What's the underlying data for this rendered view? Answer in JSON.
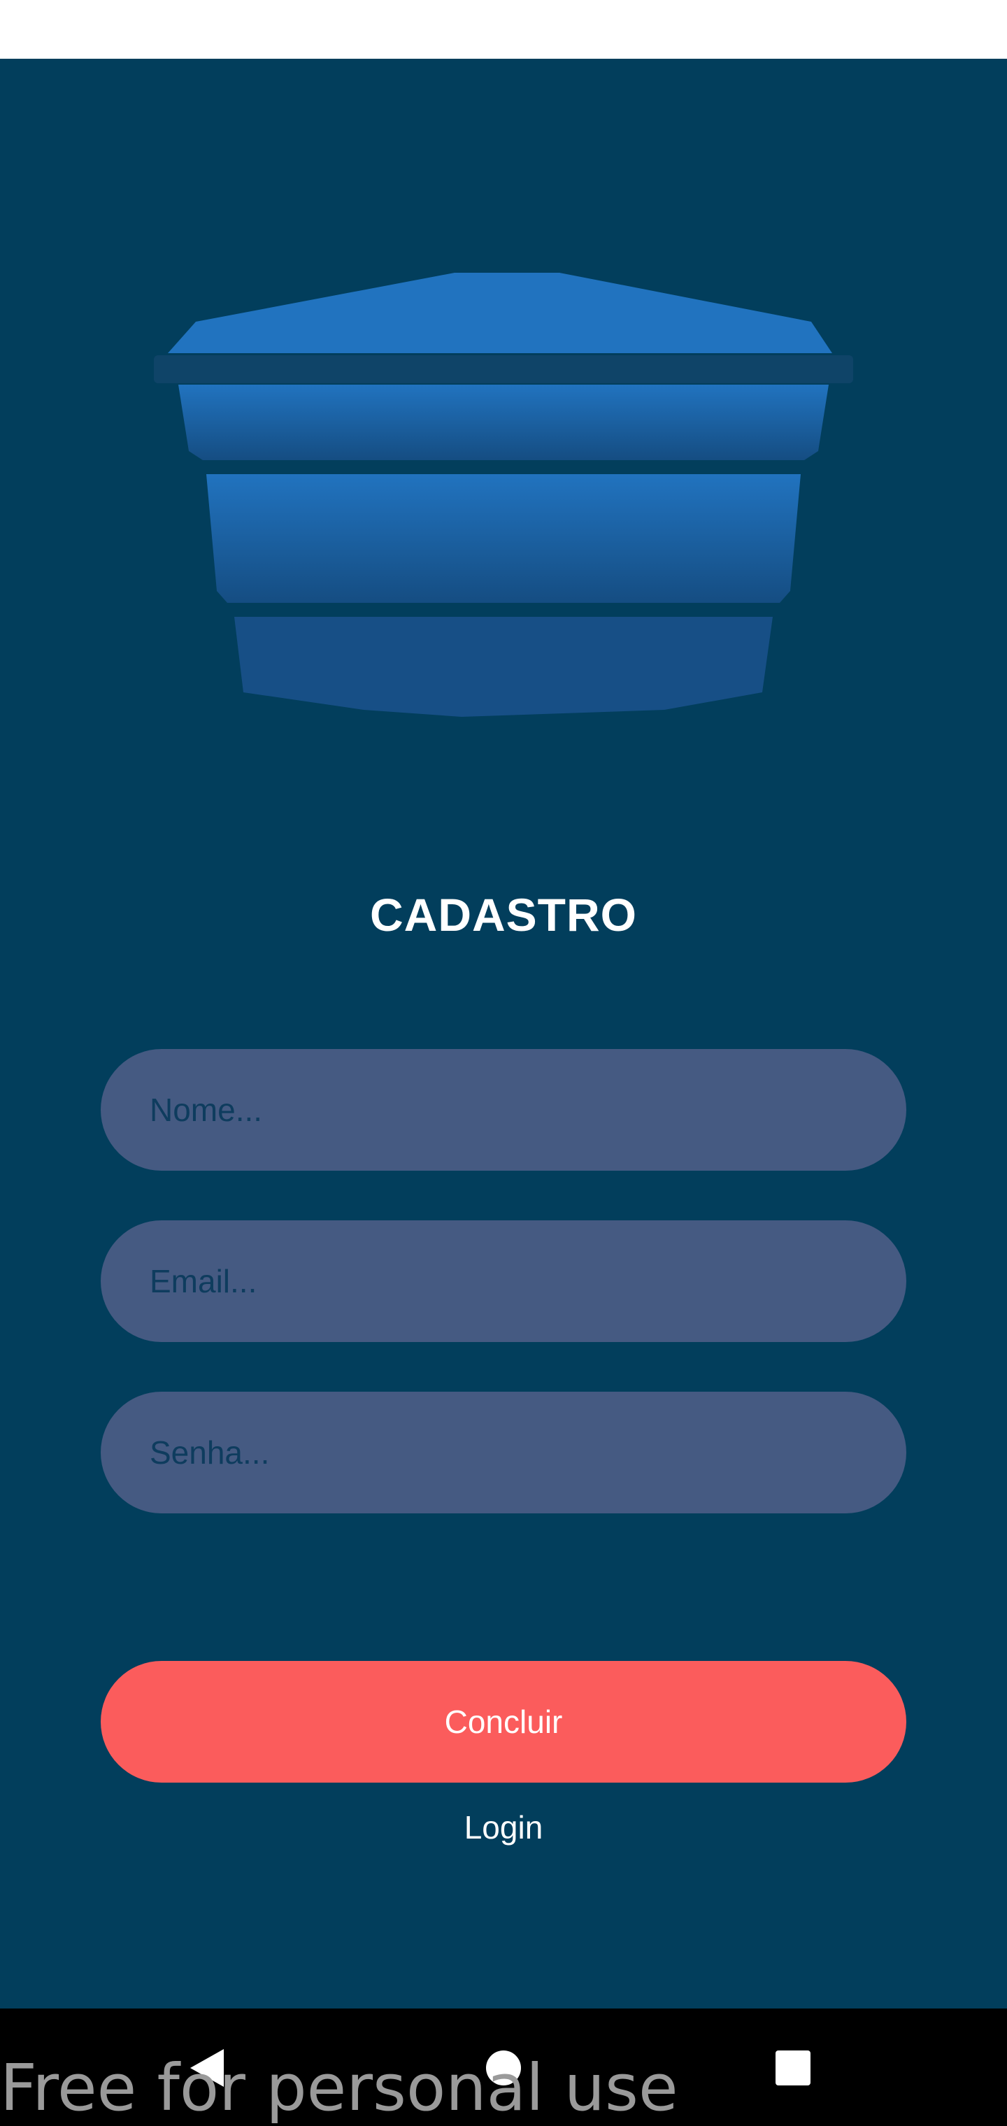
{
  "screen": {
    "title": "CADASTRO",
    "background": "#023e5c"
  },
  "logo": {
    "icon": "water-tank-icon",
    "color": "#1f6fb8"
  },
  "form": {
    "name_placeholder": "Nome...",
    "email_placeholder": "Email...",
    "password_placeholder": "Senha...",
    "field_color": "#455a82"
  },
  "actions": {
    "submit_label": "Concluir",
    "submit_color": "#fb5c5c",
    "login_label": "Login"
  },
  "nav": {
    "back_icon": "back-triangle-icon",
    "home_icon": "home-circle-icon",
    "recents_icon": "recents-square-icon"
  },
  "watermark": {
    "text": "Free for personal use"
  }
}
